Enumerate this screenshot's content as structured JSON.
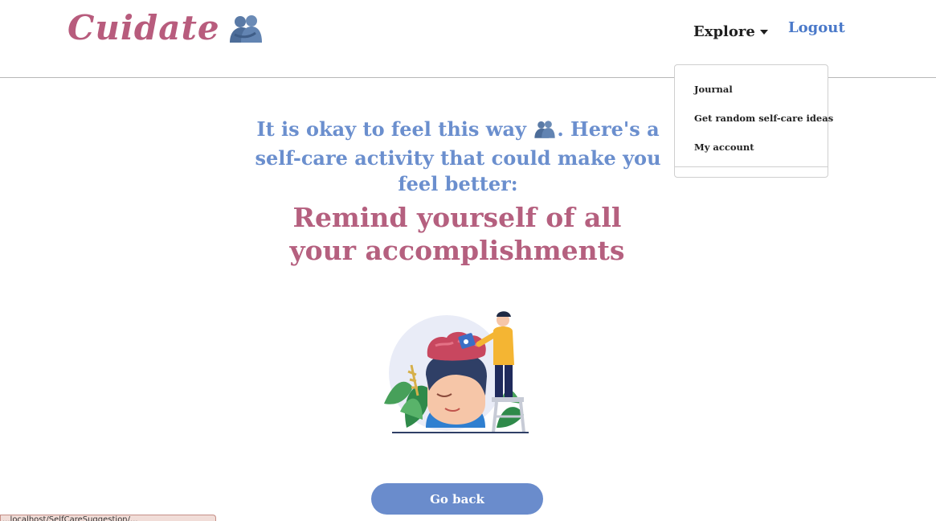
{
  "brand": {
    "name": "Cuidate",
    "icon": "people-hugging-icon"
  },
  "nav": {
    "explore_label": "Explore",
    "logout_label": "Logout",
    "dropdown_items": [
      "Journal",
      "Get random self-care ideas",
      "My account"
    ]
  },
  "headline": {
    "part1": "It is okay to feel this way",
    "part2": ". Here's a self-care activity that could make you feel better:",
    "icon": "people-hugging-icon"
  },
  "activity": {
    "text": "Remind yourself of all your accomplishments",
    "illustration": "self-care-illustration"
  },
  "actions": {
    "go_back_label": "Go back"
  },
  "status_bar": {
    "url_text": "...localhost/SelfCareSuggestion/..."
  },
  "colors": {
    "brand_pink": "#b85c7d",
    "accent_blue": "#6a8ccc",
    "link_blue": "#4a79c9"
  }
}
